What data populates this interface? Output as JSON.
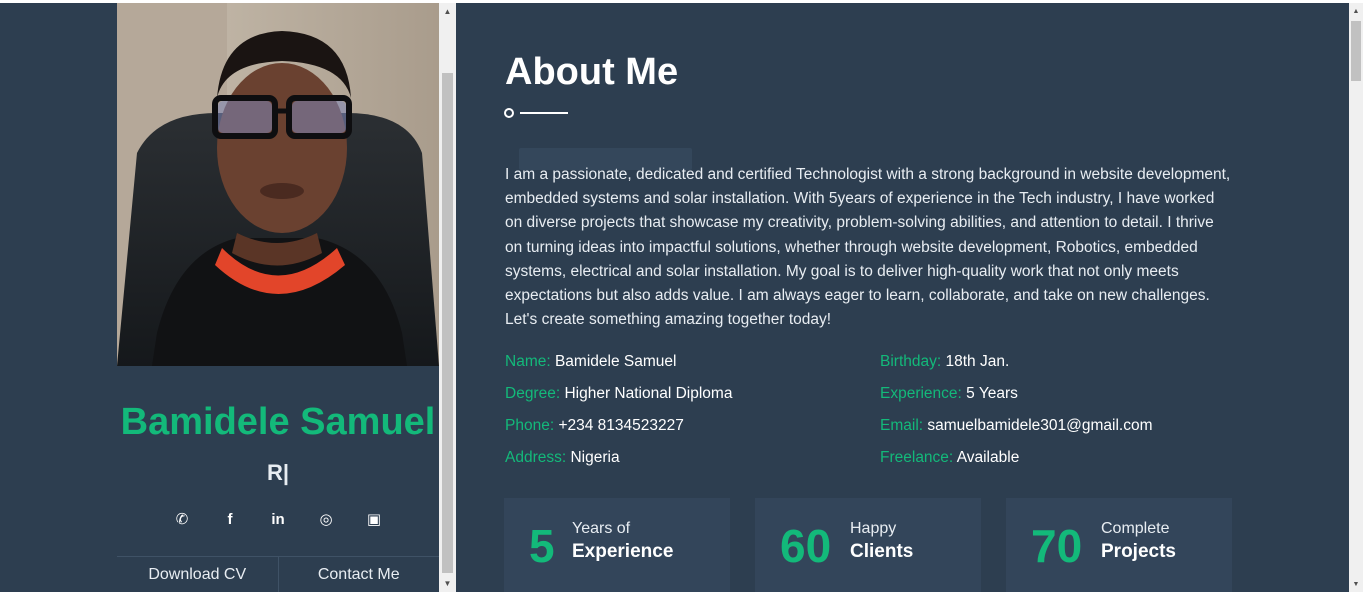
{
  "sidebar": {
    "name": "Bamidele Samuel",
    "role_typing": "R|",
    "socials": [
      {
        "icon": "whatsapp-icon",
        "glyph": "✆"
      },
      {
        "icon": "facebook-icon",
        "glyph": "f"
      },
      {
        "icon": "linkedin-icon",
        "glyph": "in"
      },
      {
        "icon": "instagram-icon",
        "glyph": "◎"
      },
      {
        "icon": "briefcase-icon",
        "glyph": "▣"
      }
    ],
    "download_cv": "Download CV",
    "contact_me": "Contact Me"
  },
  "main": {
    "title": "About Me",
    "about": "I am a passionate, dedicated and certified Technologist with a strong background in website development, embedded systems and solar installation. With 5years of experience in the Tech industry, I have worked on diverse projects that showcase my creativity, problem-solving abilities, and attention to detail. I thrive on turning ideas into impactful solutions, whether through website development, Robotics, embedded systems, electrical and solar installation. My goal is to deliver high-quality work that not only meets expectations but also adds value. I am always eager to learn, collaborate, and take on new challenges. Let's create something amazing together today!",
    "info_left": [
      {
        "key": "Name:",
        "value": "Bamidele Samuel"
      },
      {
        "key": "Degree:",
        "value": "Higher National Diploma"
      },
      {
        "key": "Phone:",
        "value": "+234 8134523227"
      },
      {
        "key": "Address:",
        "value": "Nigeria"
      }
    ],
    "info_right": [
      {
        "key": "Birthday:",
        "value": "18th Jan."
      },
      {
        "key": "Experience:",
        "value": "5 Years"
      },
      {
        "key": "Email:",
        "value": "samuelbamidele301@gmail.com"
      },
      {
        "key": "Freelance:",
        "value": "Available"
      }
    ],
    "stats": [
      {
        "number": "5",
        "line1": "Years of",
        "line2": "Experience"
      },
      {
        "number": "60",
        "line1": "Happy",
        "line2": "Clients"
      },
      {
        "number": "70",
        "line1": "Complete",
        "line2": "Projects"
      }
    ]
  },
  "colors": {
    "background": "#2d3e50",
    "accent": "#13b97a",
    "card": "#33455a"
  }
}
